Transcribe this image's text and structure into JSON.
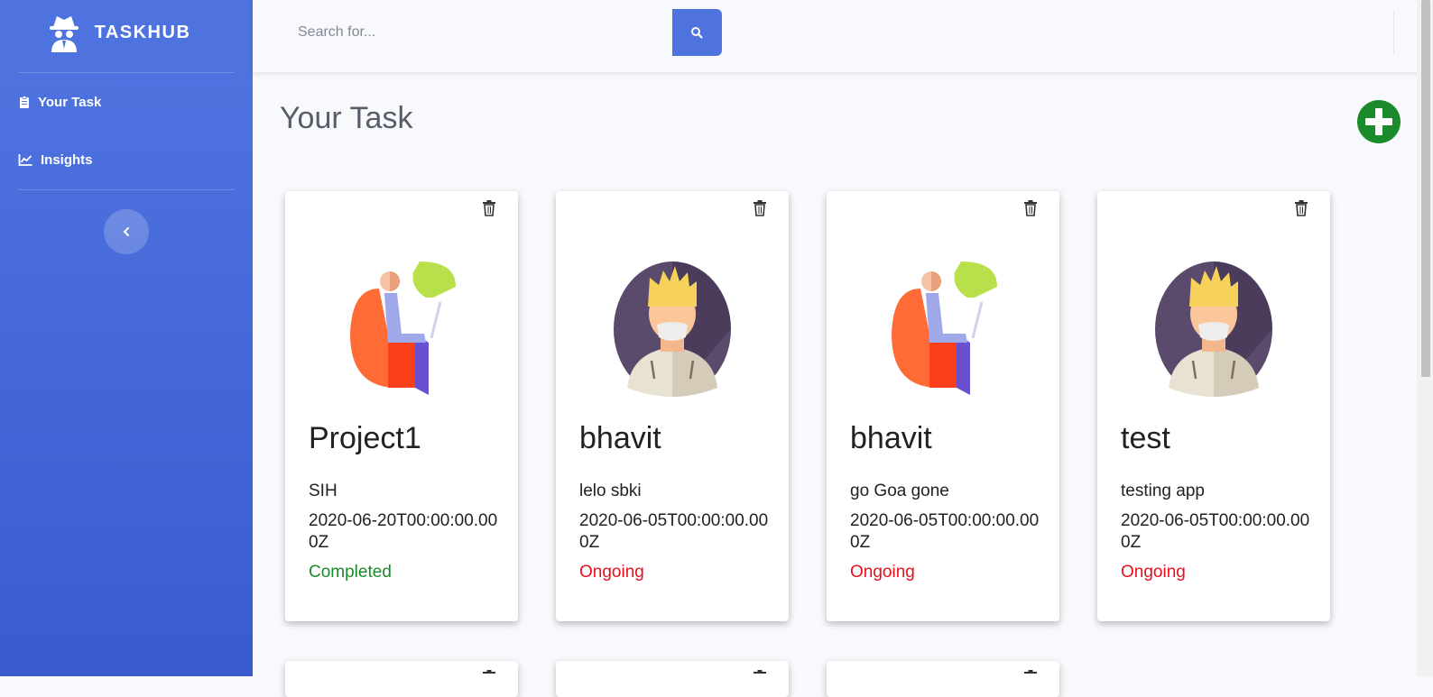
{
  "brand": {
    "name": "TASKHUB",
    "icon": "spy-icon"
  },
  "sidebar": {
    "items": [
      {
        "label": "Your Task",
        "icon": "clipboard-icon"
      },
      {
        "label": "Insights",
        "icon": "chart-area-icon"
      }
    ],
    "toggle_icon": "chevron-left-icon"
  },
  "search": {
    "placeholder": "Search for...",
    "value": "",
    "button_icon": "search-icon"
  },
  "page": {
    "title": "Your Task",
    "add_icon": "plus-circle-icon"
  },
  "colors": {
    "sidebar": "#4e73df",
    "search_button": "#4e73df",
    "add_button": "#1a8a2a",
    "status_completed": "#1a8a2a",
    "status_ongoing": "#e8101e"
  },
  "tasks": [
    {
      "title": "Project1",
      "description": "SIH",
      "date": "2020-06-20T00:00:00.000Z",
      "status": "Completed",
      "avatar": "person-in-chair-icon"
    },
    {
      "title": "bhavit",
      "description": "lelo sbki",
      "date": "2020-06-05T00:00:00.000Z",
      "status": "Ongoing",
      "avatar": "masked-man-avatar-icon"
    },
    {
      "title": "bhavit",
      "description": "go Goa gone",
      "date": "2020-06-05T00:00:00.000Z",
      "status": "Ongoing",
      "avatar": "person-in-chair-icon"
    },
    {
      "title": "test",
      "description": "testing app",
      "date": "2020-06-05T00:00:00.000Z",
      "status": "Ongoing",
      "avatar": "masked-man-avatar-icon"
    }
  ]
}
